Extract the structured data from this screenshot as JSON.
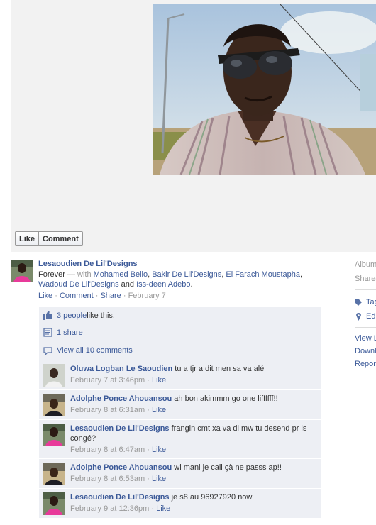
{
  "photo_actions": {
    "like": "Like",
    "comment": "Comment"
  },
  "story": {
    "author": "Lesaoudien De Lil'Designs",
    "status": "Forever",
    "with_prefix": " — with ",
    "tagged": [
      "Mohamed Bello",
      "Bakir De Lil'Designs",
      "El Farach Moustapha",
      "Wadoud De Lil'Designs",
      "Iss-deen Adebo"
    ],
    "meta": {
      "like": "Like",
      "comment": "Comment",
      "share": "Share",
      "date": "February 7"
    }
  },
  "ufi": {
    "likes_link": "3 people",
    "likes_suffix": " like this.",
    "shares": "1 share",
    "view_all": "View all 10 comments"
  },
  "comments": [
    {
      "author": "Oluwa Logban Le Saoudien",
      "text": "tu a tjr a dit men sa va alé",
      "time": "February 7 at 3:46pm",
      "like": "Like"
    },
    {
      "author": "Adolphe Ponce Ahouansou",
      "text": "ah bon akimmm go one liffffff!!",
      "time": "February 8 at 6:31am",
      "like": "Like"
    },
    {
      "author": "Lesaoudien De Lil'Designs",
      "text": "frangin cmt xa va di mw tu desend pr ls congé?",
      "time": "February 8 at 6:47am",
      "like": "Like"
    },
    {
      "author": "Adolphe Ponce Ahouansou",
      "text": "wi mani je call çà ne passs ap!!",
      "time": "February 8 at 6:53am",
      "like": "Like"
    },
    {
      "author": "Lesaoudien De Lil'Designs",
      "text": "je s8 au 96927920 now",
      "time": "February 9 at 12:36pm",
      "like": "Like"
    }
  ],
  "right_column": {
    "album": "Album",
    "shared": "Shared",
    "tag": "Tag",
    "edit": "Edit",
    "view_large": "View L",
    "download": "Downl",
    "report": "Repor"
  },
  "colors": {
    "link": "#3b5998",
    "ufi_bg": "#edeff4",
    "stage_bg": "#f2f2f2"
  }
}
